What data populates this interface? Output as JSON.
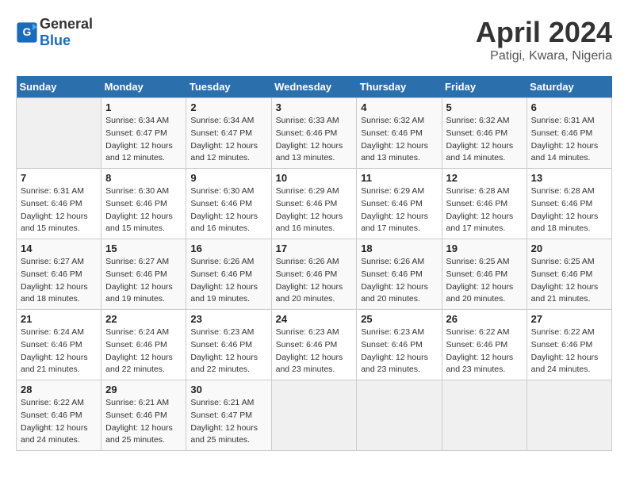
{
  "header": {
    "logo_general": "General",
    "logo_blue": "Blue",
    "title": "April 2024",
    "location": "Patigi, Kwara, Nigeria"
  },
  "calendar": {
    "days_of_week": [
      "Sunday",
      "Monday",
      "Tuesday",
      "Wednesday",
      "Thursday",
      "Friday",
      "Saturday"
    ],
    "weeks": [
      [
        {
          "day": "",
          "info": ""
        },
        {
          "day": "1",
          "info": "Sunrise: 6:34 AM\nSunset: 6:47 PM\nDaylight: 12 hours\nand 12 minutes."
        },
        {
          "day": "2",
          "info": "Sunrise: 6:34 AM\nSunset: 6:47 PM\nDaylight: 12 hours\nand 12 minutes."
        },
        {
          "day": "3",
          "info": "Sunrise: 6:33 AM\nSunset: 6:46 PM\nDaylight: 12 hours\nand 13 minutes."
        },
        {
          "day": "4",
          "info": "Sunrise: 6:32 AM\nSunset: 6:46 PM\nDaylight: 12 hours\nand 13 minutes."
        },
        {
          "day": "5",
          "info": "Sunrise: 6:32 AM\nSunset: 6:46 PM\nDaylight: 12 hours\nand 14 minutes."
        },
        {
          "day": "6",
          "info": "Sunrise: 6:31 AM\nSunset: 6:46 PM\nDaylight: 12 hours\nand 14 minutes."
        }
      ],
      [
        {
          "day": "7",
          "info": "Sunrise: 6:31 AM\nSunset: 6:46 PM\nDaylight: 12 hours\nand 15 minutes."
        },
        {
          "day": "8",
          "info": "Sunrise: 6:30 AM\nSunset: 6:46 PM\nDaylight: 12 hours\nand 15 minutes."
        },
        {
          "day": "9",
          "info": "Sunrise: 6:30 AM\nSunset: 6:46 PM\nDaylight: 12 hours\nand 16 minutes."
        },
        {
          "day": "10",
          "info": "Sunrise: 6:29 AM\nSunset: 6:46 PM\nDaylight: 12 hours\nand 16 minutes."
        },
        {
          "day": "11",
          "info": "Sunrise: 6:29 AM\nSunset: 6:46 PM\nDaylight: 12 hours\nand 17 minutes."
        },
        {
          "day": "12",
          "info": "Sunrise: 6:28 AM\nSunset: 6:46 PM\nDaylight: 12 hours\nand 17 minutes."
        },
        {
          "day": "13",
          "info": "Sunrise: 6:28 AM\nSunset: 6:46 PM\nDaylight: 12 hours\nand 18 minutes."
        }
      ],
      [
        {
          "day": "14",
          "info": "Sunrise: 6:27 AM\nSunset: 6:46 PM\nDaylight: 12 hours\nand 18 minutes."
        },
        {
          "day": "15",
          "info": "Sunrise: 6:27 AM\nSunset: 6:46 PM\nDaylight: 12 hours\nand 19 minutes."
        },
        {
          "day": "16",
          "info": "Sunrise: 6:26 AM\nSunset: 6:46 PM\nDaylight: 12 hours\nand 19 minutes."
        },
        {
          "day": "17",
          "info": "Sunrise: 6:26 AM\nSunset: 6:46 PM\nDaylight: 12 hours\nand 20 minutes."
        },
        {
          "day": "18",
          "info": "Sunrise: 6:26 AM\nSunset: 6:46 PM\nDaylight: 12 hours\nand 20 minutes."
        },
        {
          "day": "19",
          "info": "Sunrise: 6:25 AM\nSunset: 6:46 PM\nDaylight: 12 hours\nand 20 minutes."
        },
        {
          "day": "20",
          "info": "Sunrise: 6:25 AM\nSunset: 6:46 PM\nDaylight: 12 hours\nand 21 minutes."
        }
      ],
      [
        {
          "day": "21",
          "info": "Sunrise: 6:24 AM\nSunset: 6:46 PM\nDaylight: 12 hours\nand 21 minutes."
        },
        {
          "day": "22",
          "info": "Sunrise: 6:24 AM\nSunset: 6:46 PM\nDaylight: 12 hours\nand 22 minutes."
        },
        {
          "day": "23",
          "info": "Sunrise: 6:23 AM\nSunset: 6:46 PM\nDaylight: 12 hours\nand 22 minutes."
        },
        {
          "day": "24",
          "info": "Sunrise: 6:23 AM\nSunset: 6:46 PM\nDaylight: 12 hours\nand 23 minutes."
        },
        {
          "day": "25",
          "info": "Sunrise: 6:23 AM\nSunset: 6:46 PM\nDaylight: 12 hours\nand 23 minutes."
        },
        {
          "day": "26",
          "info": "Sunrise: 6:22 AM\nSunset: 6:46 PM\nDaylight: 12 hours\nand 23 minutes."
        },
        {
          "day": "27",
          "info": "Sunrise: 6:22 AM\nSunset: 6:46 PM\nDaylight: 12 hours\nand 24 minutes."
        }
      ],
      [
        {
          "day": "28",
          "info": "Sunrise: 6:22 AM\nSunset: 6:46 PM\nDaylight: 12 hours\nand 24 minutes."
        },
        {
          "day": "29",
          "info": "Sunrise: 6:21 AM\nSunset: 6:46 PM\nDaylight: 12 hours\nand 25 minutes."
        },
        {
          "day": "30",
          "info": "Sunrise: 6:21 AM\nSunset: 6:47 PM\nDaylight: 12 hours\nand 25 minutes."
        },
        {
          "day": "",
          "info": ""
        },
        {
          "day": "",
          "info": ""
        },
        {
          "day": "",
          "info": ""
        },
        {
          "day": "",
          "info": ""
        }
      ]
    ]
  }
}
